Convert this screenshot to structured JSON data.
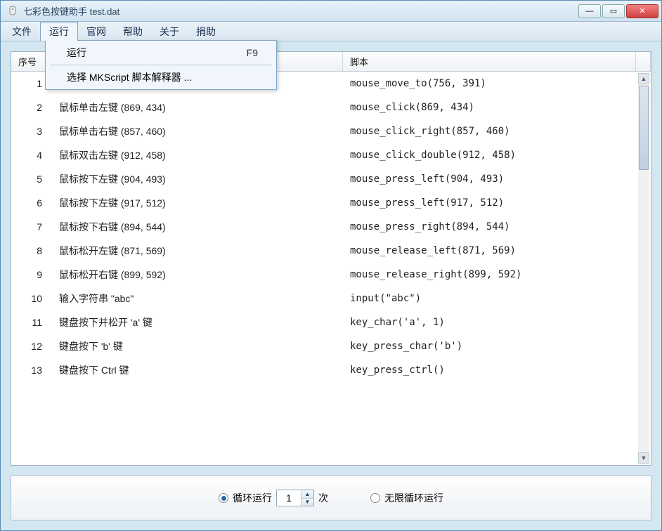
{
  "window": {
    "title": "七彩色按键助手   test.dat"
  },
  "menubar": {
    "items": [
      "文件",
      "运行",
      "官网",
      "帮助",
      "关于",
      "捐助"
    ],
    "open_index": 1
  },
  "dropdown": {
    "items": [
      {
        "label": "运行",
        "shortcut": "F9"
      },
      {
        "label": "选择 MKScript 脚本解释器 ..."
      }
    ]
  },
  "table": {
    "headers": {
      "index": "序号",
      "script": "脚本"
    },
    "rows": [
      {
        "idx": "1",
        "action": "",
        "script": "mouse_move_to(756, 391)"
      },
      {
        "idx": "2",
        "action": "鼠标单击左键 (869, 434)",
        "script": "mouse_click(869, 434)"
      },
      {
        "idx": "3",
        "action": "鼠标单击右键 (857, 460)",
        "script": "mouse_click_right(857, 460)"
      },
      {
        "idx": "4",
        "action": "鼠标双击左键 (912, 458)",
        "script": "mouse_click_double(912, 458)"
      },
      {
        "idx": "5",
        "action": "鼠标按下左键 (904, 493)",
        "script": "mouse_press_left(904, 493)"
      },
      {
        "idx": "6",
        "action": "鼠标按下左键 (917, 512)",
        "script": "mouse_press_left(917, 512)"
      },
      {
        "idx": "7",
        "action": "鼠标按下右键 (894, 544)",
        "script": "mouse_press_right(894, 544)"
      },
      {
        "idx": "8",
        "action": "鼠标松开左键 (871, 569)",
        "script": "mouse_release_left(871, 569)"
      },
      {
        "idx": "9",
        "action": "鼠标松开右键 (899, 592)",
        "script": "mouse_release_right(899, 592)"
      },
      {
        "idx": "10",
        "action": "输入字符串 \"abc\"",
        "script": "input(\"abc\")"
      },
      {
        "idx": "11",
        "action": "键盘按下并松开 'a' 键",
        "script": "key_char('a', 1)"
      },
      {
        "idx": "12",
        "action": "键盘按下 'b' 键",
        "script": "key_press_char('b')"
      },
      {
        "idx": "13",
        "action": "键盘按下 Ctrl 键",
        "script": "key_press_ctrl()"
      }
    ]
  },
  "footer": {
    "loop_label_prefix": "循环运行",
    "loop_count": "1",
    "loop_label_suffix": "次",
    "infinite_label": "无限循环运行",
    "selected": "loop"
  }
}
